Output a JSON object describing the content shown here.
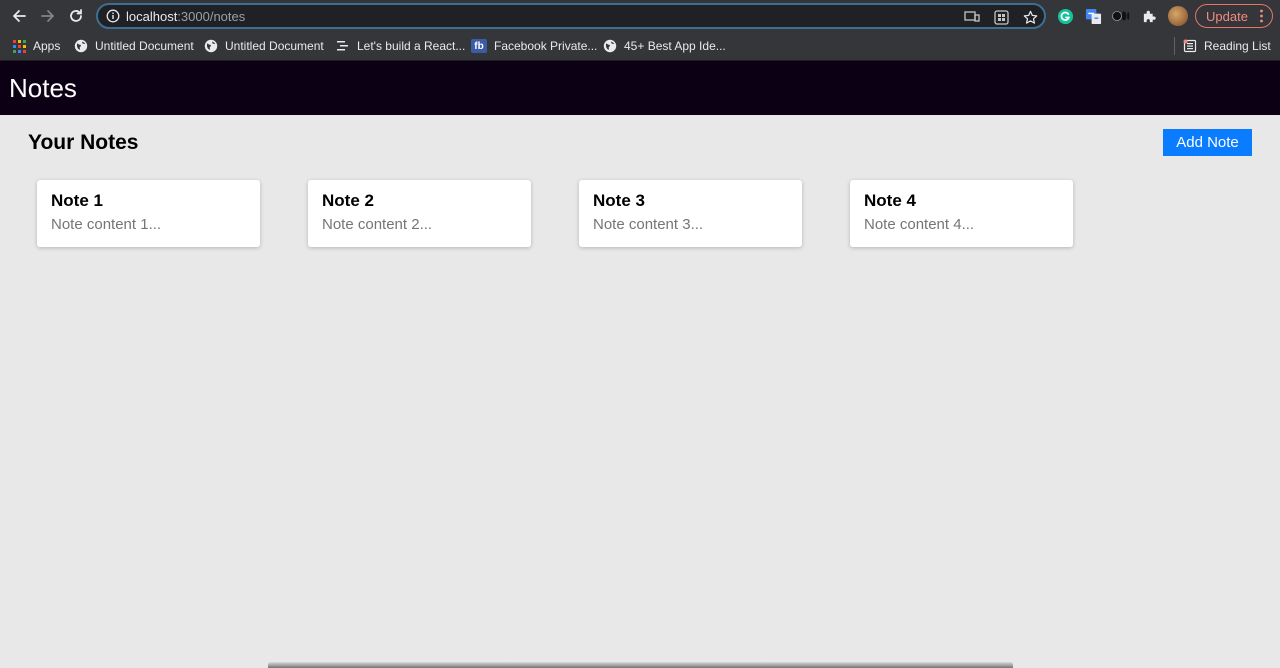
{
  "browser": {
    "url_host": "localhost",
    "url_rest": ":3000/notes",
    "update_label": "Update",
    "bookmarks": [
      {
        "label": "Apps",
        "icon": "apps-grid-icon"
      },
      {
        "label": "Untitled Document",
        "icon": "globe-icon"
      },
      {
        "label": "Untitled Document",
        "icon": "globe-icon"
      },
      {
        "label": "Let's build a React...",
        "icon": "list-icon"
      },
      {
        "label": "Facebook Private...",
        "icon": "fb-icon",
        "icon_text": "fb"
      },
      {
        "label": "45+ Best App Ide...",
        "icon": "globe-icon"
      }
    ],
    "reading_list": "Reading List",
    "colors": {
      "chrome_bg": "#35363a",
      "omnibox_bg": "#202124",
      "update_accent": "#f28b82"
    }
  },
  "app": {
    "title": "Notes",
    "section_title": "Your Notes",
    "add_button": "Add Note",
    "notes": [
      {
        "title": "Note 1",
        "content": "Note content 1..."
      },
      {
        "title": "Note 2",
        "content": "Note content 2..."
      },
      {
        "title": "Note 3",
        "content": "Note content 3..."
      },
      {
        "title": "Note 4",
        "content": "Note content 4..."
      }
    ],
    "colors": {
      "header_bg": "#0c0015",
      "page_bg": "#e8e8e8",
      "button_bg": "#0a7cff"
    }
  }
}
